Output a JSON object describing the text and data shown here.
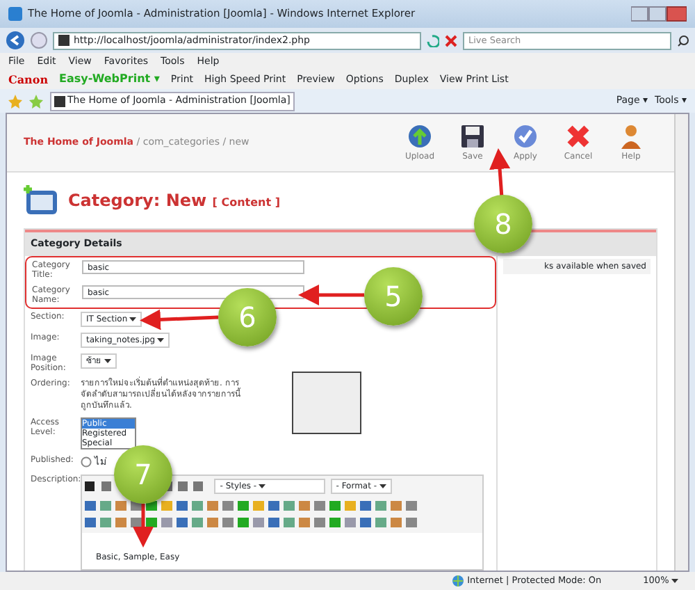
{
  "window": {
    "title": "The Home of Joomla - Administration [Joomla] - Windows Internet Explorer"
  },
  "address_bar": {
    "url": "http://localhost/joomla/administrator/index2.php",
    "search_placeholder": "Live Search"
  },
  "menu": [
    "File",
    "Edit",
    "View",
    "Favorites",
    "Tools",
    "Help"
  ],
  "print_toolbar": {
    "brand": "Canon",
    "product": "Easy-WebPrint ▾",
    "buttons": [
      "Print",
      "High Speed Print",
      "Preview",
      "Options",
      "Duplex",
      "View Print List"
    ]
  },
  "tab": {
    "title": "The Home of Joomla - Administration [Joomla]",
    "tools": [
      "Page ▾",
      "Tools ▾"
    ]
  },
  "breadcrumb": {
    "site": "The Home of Joomla",
    "path": " / com_categories / new"
  },
  "toolbar": [
    {
      "kind": "upload",
      "label": "Upload"
    },
    {
      "kind": "save",
      "label": "Save"
    },
    {
      "kind": "apply",
      "label": "Apply"
    },
    {
      "kind": "cancel",
      "label": "Cancel"
    },
    {
      "kind": "help",
      "label": "Help"
    }
  ],
  "heading": {
    "title": "Category: New",
    "context": "[ Content ]"
  },
  "details": {
    "title": "Category Details",
    "side_note": "ks available when saved",
    "fields": [
      {
        "kind": "text",
        "label": "Category Title:",
        "value": "basic",
        "boxed": true
      },
      {
        "kind": "text",
        "label": "Category Name:",
        "value": "basic",
        "boxed": true
      },
      {
        "kind": "select",
        "label": "Section:",
        "value": "IT Section",
        "boxed": false
      },
      {
        "kind": "select",
        "label": "Image:",
        "value": "taking_notes.jpg",
        "boxed": false
      },
      {
        "kind": "select",
        "label": "Image Position:",
        "value": "ซ้าย",
        "boxed": false
      },
      {
        "kind": "note",
        "label": "Ordering:",
        "text": "รายการใหม่จะเริ่มต้นที่ตำแหน่งสุดท้าย. การจัดลำดับสามารถเปลี่ยนได้หลังจากรายการนี้ถูกบันทึกแล้ว.",
        "boxed": false
      },
      {
        "kind": "list",
        "label": "Access Level:",
        "options": [
          {
            "label": "Public",
            "selected": true
          },
          {
            "label": "Registered",
            "selected": false
          },
          {
            "label": "Special",
            "selected": false
          }
        ],
        "boxed": false
      },
      {
        "kind": "radio",
        "label": "Published:",
        "options": [
          {
            "label": "ไม่",
            "selected": false
          }
        ],
        "boxed": false
      },
      {
        "kind": "editor",
        "label": "Description:",
        "styles": "- Styles -",
        "format": "- Format -",
        "content": "Basic, Sample, Easy",
        "boxed": false
      }
    ]
  },
  "annotations": [
    {
      "label": "8"
    },
    {
      "label": "5"
    },
    {
      "label": "6"
    },
    {
      "label": "7"
    }
  ],
  "status_bar": {
    "zone": "Internet | Protected Mode: On",
    "zoom": "100%"
  }
}
